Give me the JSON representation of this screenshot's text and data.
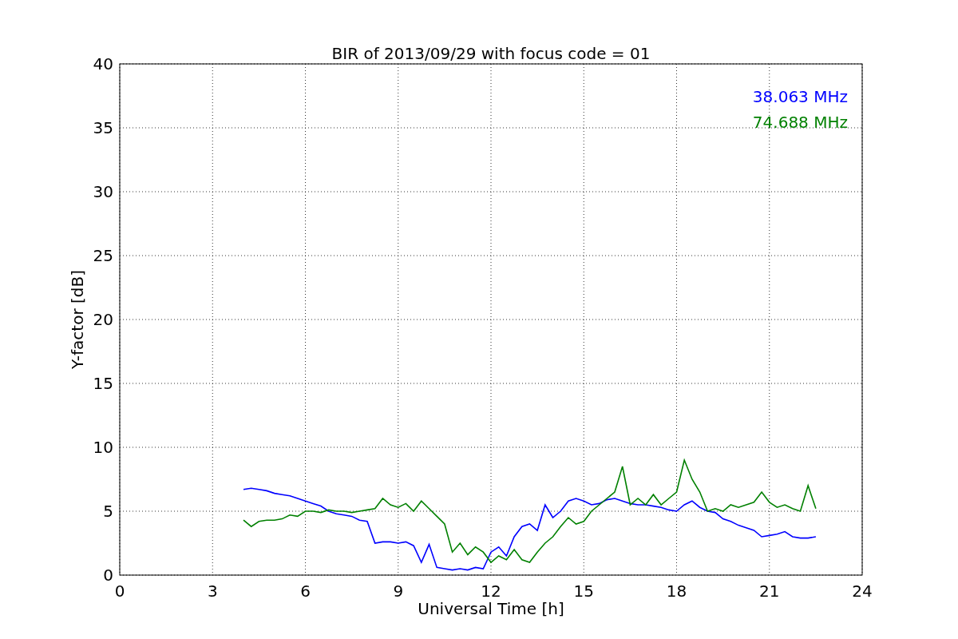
{
  "chart_data": {
    "type": "line",
    "title": "BIR of 2013/09/29 with focus code = 01",
    "xlabel": "Universal Time [h]",
    "ylabel": "Y-factor [dB]",
    "x": [
      4.0,
      4.25,
      4.5,
      4.75,
      5.0,
      5.25,
      5.5,
      5.75,
      6.0,
      6.25,
      6.5,
      6.75,
      7.0,
      7.25,
      7.5,
      7.75,
      8.0,
      8.25,
      8.5,
      8.75,
      9.0,
      9.25,
      9.5,
      9.75,
      10.0,
      10.25,
      10.5,
      10.75,
      11.0,
      11.25,
      11.5,
      11.75,
      12.0,
      12.25,
      12.5,
      12.75,
      13.0,
      13.25,
      13.5,
      13.75,
      14.0,
      14.25,
      14.5,
      14.75,
      15.0,
      15.25,
      15.5,
      15.75,
      16.0,
      16.25,
      16.5,
      16.75,
      17.0,
      17.25,
      17.5,
      17.75,
      18.0,
      18.25,
      18.5,
      18.75,
      19.0,
      19.25,
      19.5,
      19.75,
      20.0,
      20.25,
      20.5,
      20.75,
      21.0,
      21.25,
      21.5,
      21.75,
      22.0,
      22.25,
      22.5
    ],
    "series": [
      {
        "name": "38.063 MHz",
        "color": "#0000ff",
        "values": [
          6.7,
          6.8,
          6.7,
          6.6,
          6.4,
          6.3,
          6.2,
          6.0,
          5.8,
          5.6,
          5.4,
          5.0,
          4.8,
          4.7,
          4.6,
          4.3,
          4.2,
          2.5,
          2.6,
          2.6,
          2.5,
          2.6,
          2.3,
          1.0,
          2.4,
          0.6,
          0.5,
          0.4,
          0.5,
          0.4,
          0.6,
          0.5,
          1.8,
          2.2,
          1.5,
          3.0,
          3.8,
          4.0,
          3.5,
          5.5,
          4.5,
          5.0,
          5.8,
          6.0,
          5.8,
          5.5,
          5.6,
          5.9,
          6.0,
          5.8,
          5.6,
          5.5,
          5.5,
          5.4,
          5.3,
          5.1,
          5.0,
          5.5,
          5.8,
          5.3,
          5.0,
          4.9,
          4.4,
          4.2,
          3.9,
          3.7,
          3.5,
          3.0,
          3.1,
          3.2,
          3.4,
          3.0,
          2.9,
          2.9,
          3.0
        ]
      },
      {
        "name": "74.688 MHz",
        "color": "#008000",
        "values": [
          4.3,
          3.8,
          4.2,
          4.3,
          4.3,
          4.4,
          4.7,
          4.6,
          5.0,
          5.0,
          4.9,
          5.1,
          5.0,
          5.0,
          4.9,
          5.0,
          5.1,
          5.2,
          6.0,
          5.5,
          5.3,
          5.6,
          5.0,
          5.8,
          5.2,
          4.6,
          4.0,
          1.8,
          2.5,
          1.6,
          2.2,
          1.8,
          1.0,
          1.5,
          1.2,
          2.0,
          1.2,
          1.0,
          1.8,
          2.5,
          3.0,
          3.8,
          4.5,
          4.0,
          4.2,
          5.0,
          5.5,
          6.0,
          6.5,
          8.5,
          5.5,
          6.0,
          5.5,
          6.3,
          5.5,
          6.0,
          6.5,
          9.0,
          7.5,
          6.5,
          5.0,
          5.2,
          5.0,
          5.5,
          5.3,
          5.5,
          5.7,
          6.5,
          5.7,
          5.3,
          5.5,
          5.2,
          5.0,
          7.0,
          5.2
        ]
      }
    ],
    "xlim": [
      0,
      24
    ],
    "ylim": [
      0,
      40
    ],
    "xticks": [
      0,
      3,
      6,
      9,
      12,
      15,
      18,
      21,
      24
    ],
    "yticks": [
      0,
      5,
      10,
      15,
      20,
      25,
      30,
      35,
      40
    ],
    "grid": true
  }
}
